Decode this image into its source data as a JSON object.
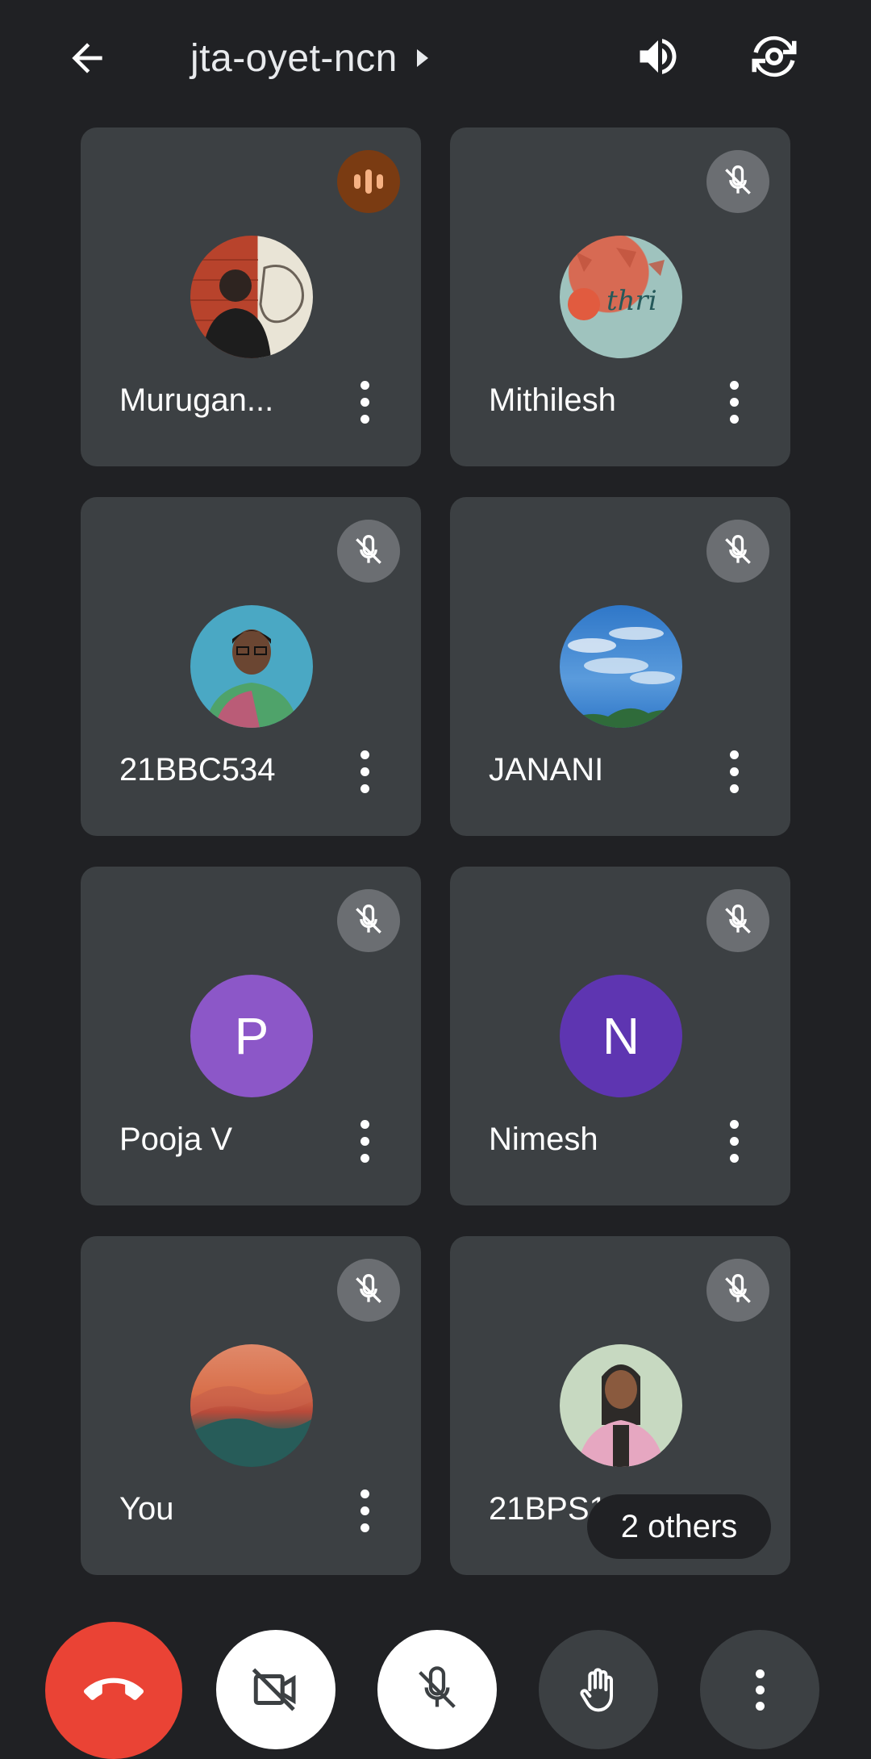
{
  "header": {
    "meeting_code": "jta-oyet-ncn",
    "icons": {
      "back": "arrow-left-icon",
      "speaker": "volume-icon",
      "switch_camera": "camera-switch-icon"
    }
  },
  "participants": [
    {
      "name": "Murugan...",
      "avatar_type": "photo",
      "status": "speaking",
      "avatar_colors": [
        "#b8432c",
        "#2b2b2b",
        "#e9e4d6"
      ]
    },
    {
      "name": "Mithilesh",
      "avatar_type": "photo",
      "status": "muted",
      "avatar_colors": [
        "#d76a53",
        "#6fb3b1",
        "#e15b3f"
      ]
    },
    {
      "name": "21BBC534",
      "avatar_type": "photo",
      "status": "muted",
      "avatar_colors": [
        "#4aa8c4",
        "#2e2a26",
        "#d54a7b"
      ]
    },
    {
      "name": "JANANI",
      "avatar_type": "photo",
      "status": "muted",
      "avatar_colors": [
        "#2f77c8",
        "#dbe8f5",
        "#2f6b3a"
      ]
    },
    {
      "name": "Pooja V",
      "avatar_type": "initial",
      "initial": "P",
      "status": "muted",
      "avatar_colors": [
        "#8c57c8"
      ]
    },
    {
      "name": "Nimesh",
      "avatar_type": "initial",
      "initial": "N",
      "status": "muted",
      "avatar_colors": [
        "#5e35b1"
      ]
    },
    {
      "name": "You",
      "avatar_type": "photo",
      "status": "muted",
      "avatar_colors": [
        "#d86f4a",
        "#275c59",
        "#b94a3a"
      ]
    },
    {
      "name": "21BPS15",
      "avatar_type": "photo",
      "status": "muted",
      "avatar_colors": [
        "#c7d9c1",
        "#e6a7c1",
        "#2d2a28"
      ]
    }
  ],
  "others_chip": {
    "label": "2 others"
  },
  "controls": {
    "end_call": {
      "icon": "phone-hangup-icon",
      "color": "#ea4335"
    },
    "camera": {
      "icon": "camera-off-icon"
    },
    "microphone": {
      "icon": "mic-off-icon"
    },
    "raise_hand": {
      "icon": "hand-icon"
    },
    "more": {
      "icon": "more-vertical-icon"
    }
  }
}
